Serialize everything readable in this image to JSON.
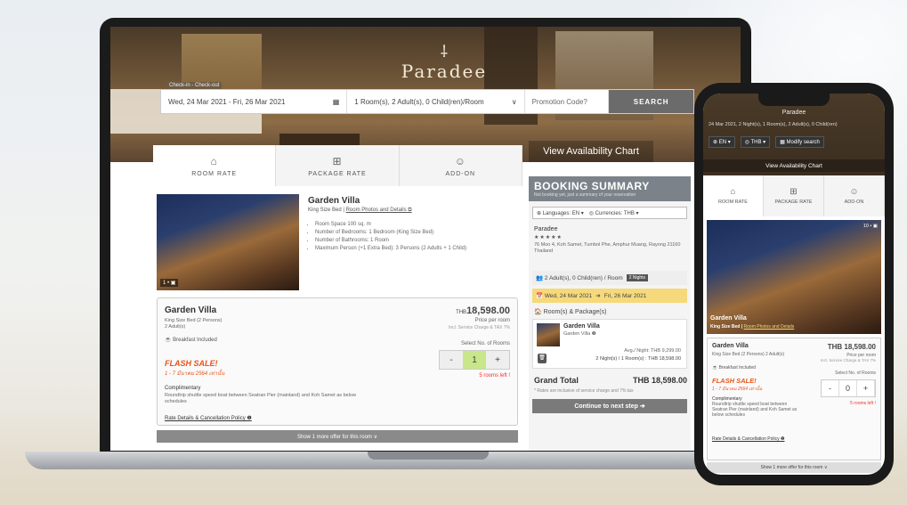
{
  "hotel": {
    "logo_mark": "⸸",
    "logo_name": "Paradee"
  },
  "search": {
    "checkin_label": "Check-in - Check-out",
    "dates": "Wed, 24 Mar 2021 - Fri, 26 Mar 2021",
    "rooms": "1 Room(s), 2 Adult(s), 0 Child(ren)/Room",
    "promo_placeholder": "Promotion Code?",
    "search_label": "SEARCH"
  },
  "view_availability": "View Availability Chart",
  "tabs": [
    {
      "label": "ROOM RATE",
      "icon": "⌂"
    },
    {
      "label": "PACKAGE RATE",
      "icon": "⊞"
    },
    {
      "label": "ADD-ON",
      "icon": "☺"
    }
  ],
  "room": {
    "title": "Garden Villa",
    "subtitle": "King Size Bed |",
    "photos_link": "Room Photos and Details ⧉",
    "image_badge": "1 • ▣",
    "features": [
      "Room Space 100 sq. m",
      "Number of Bedrooms: 1 Bedroom (King Size Bed)",
      "Number of Bathrooms: 1 Room",
      "Maximum Person (+1 Extra Bed): 3 Persons (2 Adults + 1 Child)"
    ]
  },
  "offer": {
    "title": "Garden Villa",
    "sub1": "King Size Bed (2 Persons)",
    "sub2": "2 Adult(s)",
    "breakfast": "☕ Breakfast Included",
    "flash": "FLASH SALE!",
    "flash_sub": "1 - 7 มีนาคม 2564 เท่านั้น",
    "comp_title": "Complimentary",
    "comp_text": "Roundtrip shuttle speed boat between Seatran Pier (mainland) and Koh Samet as below schedules",
    "rate_link": "Rate Details & Cancellation Policy ❶",
    "currency": "THB",
    "price": "18,598.00",
    "per": "Price per room",
    "tax": "Incl. Service Charge & TAX 7%",
    "select_label": "Select No. of Rooms",
    "minus": "-",
    "qty": "1",
    "plus": "+",
    "rooms_left": "5 rooms left !"
  },
  "show_more": "Show 1 more offer for this room ∨",
  "summary": {
    "title": "BOOKING SUMMARY",
    "note": "Not booking yet, just a summary of your reservation",
    "language": "⊕ Languages: EN ▾",
    "currency": "◎ Currencies: THB ▾",
    "hotel": "Paradee",
    "stars": "★★★★★",
    "address": "76 Moo 4, Koh Samet, Tumbol Phe, Amphur Muang, Rayong 21160 Thailand",
    "guests": "👥 2 Adult(s), 0 Child(ren) / Room",
    "nights": "2 Nights",
    "checkin": "📅 Wed, 24 Mar 2021",
    "arrow": "➔",
    "checkout": "Fri, 26 Mar 2021",
    "rooms_packages": "🏠 Room(s) & Package(s)",
    "item_title": "Garden Villa",
    "item_sub": "Garden Villa ❶",
    "avg": "Avg./ Night: THB 9,299.00",
    "line_total": "2 Night(s) / 1 Room(s) : THB 18,598.00",
    "trash": "🗑",
    "grand_label": "Grand Total",
    "grand_value": "THB 18,598.00",
    "grand_note": "* Rates are inclusive of service charge and 7% tax",
    "continue": "Continue to next step ➔"
  },
  "phone": {
    "brand": "Paradee",
    "info": "24 Mar 2021, 2 Night(s), 1 Room(s), 2 Adult(s), 0 Child(ren)",
    "lang": "⊕ EN ▾",
    "currency": "◎ THB ▾",
    "modify": "▦ Modify search",
    "availability": "View Availability Chart",
    "tabs": [
      {
        "label": "ROOM RATE",
        "icon": "⌂"
      },
      {
        "label": "PACKAGE RATE",
        "icon": "⊞"
      },
      {
        "label": "ADD-ON",
        "icon": "☺"
      }
    ],
    "img_title": "Garden Villa",
    "img_sub": "King Size Bed |",
    "img_link": "Room Photos and Details",
    "img_count": "10 • ▣",
    "offer_title": "Garden Villa",
    "offer_sub": "King Size Bed (2 Persons) 2 Adult(s)",
    "breakfast": "☕ Breakfast Included",
    "flash": "FLASH SALE!",
    "flash_sub": "1 - 7 มีนาคม 2564 เท่านั้น",
    "comp_title": "Complimentary",
    "comp_text": "Roundtrip shuttle speed boat between Seatran Pier (mainland) and Koh Samet as below schedules",
    "rate_link": "Rate Details & Cancellation Policy ❶",
    "price": "THB 18,598.00",
    "per": "Price per room",
    "tax": "Incl. Service Charge & TAX 7%",
    "select_label": "Select No. of Rooms",
    "minus": "-",
    "qty": "0",
    "plus": "+",
    "rooms_left": "5 rooms left !",
    "show_more": "Show 1 more offer for this room ∨"
  }
}
